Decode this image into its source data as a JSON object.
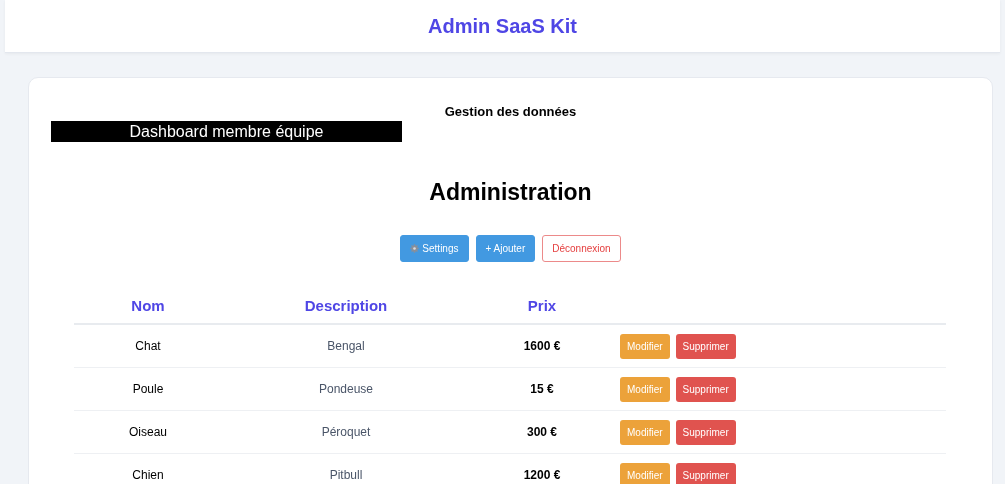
{
  "header": {
    "title": "Admin SaaS Kit"
  },
  "card": {
    "subtitle": "Gestion des données",
    "banner": "Dashboard membre équipe",
    "heading": "Administration"
  },
  "actions": [
    {
      "kind": "settings",
      "label": "Settings"
    },
    {
      "kind": "add",
      "label": "+ Ajouter"
    },
    {
      "kind": "logout",
      "label": "Déconnexion"
    }
  ],
  "table": {
    "columns": [
      "Nom",
      "Description",
      "Prix"
    ],
    "rows": [
      {
        "name": "Chat",
        "description": "Bengal",
        "price": "1600 €",
        "edit": "Modifier",
        "delete": "Supprimer"
      },
      {
        "name": "Poule",
        "description": "Pondeuse",
        "price": "15 €",
        "edit": "Modifier",
        "delete": "Supprimer"
      },
      {
        "name": "Oiseau",
        "description": "Péroquet",
        "price": "300 €",
        "edit": "Modifier",
        "delete": "Supprimer"
      },
      {
        "name": "Chien",
        "description": "Pitbull",
        "price": "1200 €",
        "edit": "Modifier",
        "delete": "Supprimer"
      }
    ]
  }
}
